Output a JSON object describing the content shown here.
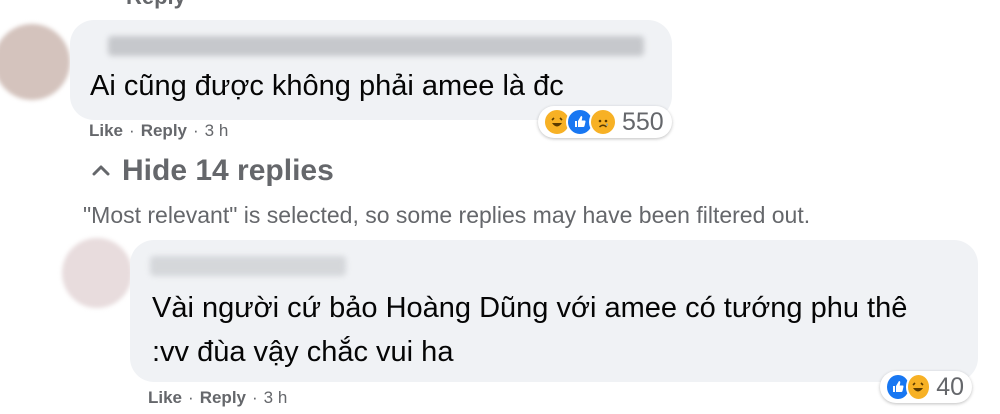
{
  "top_link": {
    "label": "Reply"
  },
  "comments": [
    {
      "text": "Ai cũng được không phải amee là đc",
      "reactions": {
        "icons": [
          "haha-icon",
          "like-icon",
          "sad-icon"
        ],
        "count": "550"
      },
      "meta": {
        "like": "Like",
        "reply": "Reply",
        "time": "3 h"
      }
    },
    {
      "text": "Vài người cứ bảo Hoàng Dũng với amee có tướng phu thê :vv đùa vậy chắc vui ha",
      "reactions": {
        "icons": [
          "like-icon",
          "haha-icon"
        ],
        "count": "40"
      },
      "meta": {
        "like": "Like",
        "reply": "Reply",
        "time": "3 h"
      }
    }
  ],
  "replies_toggle": {
    "icon": "chevron-up-icon",
    "label": "Hide 14 replies"
  },
  "filter_note": "\"Most relevant\" is selected, so some replies may have been filtered out.",
  "colors": {
    "bubble": "#f0f2f5",
    "muted_text": "#65676b",
    "like_blue": "#1877f2",
    "emoji_yellow": "#f7b125"
  }
}
